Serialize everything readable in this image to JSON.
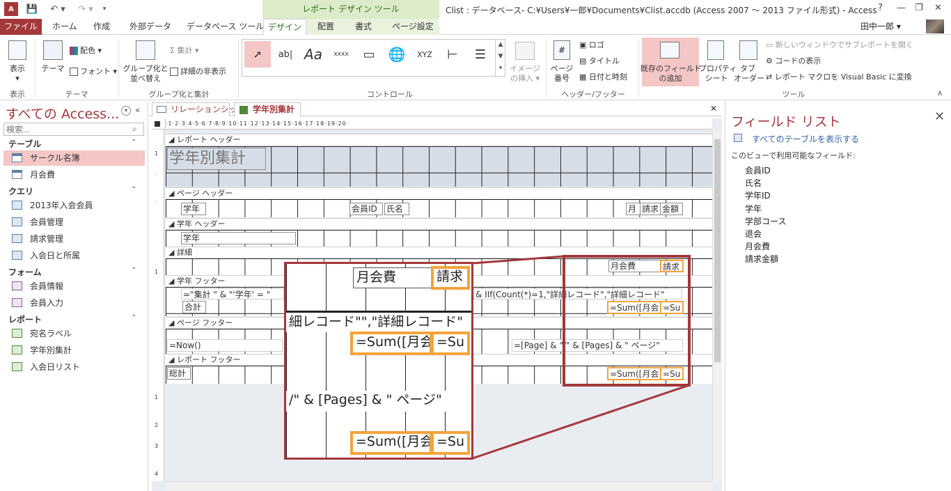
{
  "app": {
    "title": "Clist : データベース- C:¥Users¥一郎¥Documents¥Clist.accdb (Access 2007 ～ 2013 ファイル形式) - Access",
    "context_header": "レポート デザイン ツール",
    "help": "?",
    "user": "田中一郎 ▾"
  },
  "tabs": [
    "ファイル",
    "ホーム",
    "作成",
    "外部データ",
    "データベース ツール",
    "デザイン",
    "配置",
    "書式",
    "ページ設定"
  ],
  "ribbon": {
    "view": {
      "label": "表示",
      "group": "表示"
    },
    "theme": {
      "theme": "テーマ",
      "colors": "配色 ▾",
      "fonts": "フォント ▾",
      "group": "テーマ"
    },
    "grouping": {
      "group_sort": "グループ化と\n並べ替え",
      "totals": "集計 ▾",
      "hide_details": "詳細の非表示",
      "group": "グループ化と集計"
    },
    "controls": {
      "group": "コントロール",
      "image_insert": "イメージ\nの挿入 ▾"
    },
    "header_footer": {
      "page_number": "ページ\n番号",
      "logo": "ロゴ",
      "title": "タイトル",
      "datetime": "日付と時刻",
      "group": "ヘッダー/フッター"
    },
    "tools": {
      "add_fields": "既存のフィールド\nの追加",
      "property_sheet": "プロパティ\nシート",
      "tab_order": "タブ\nオーダー",
      "subreport": "新しいウィンドウでサブレポートを開く",
      "view_code": "コードの表示",
      "convert_macros": "レポート マクロを Visual Basic に変換",
      "group": "ツール"
    }
  },
  "nav": {
    "title": "すべての Access...",
    "search_placeholder": "検索...",
    "categories": [
      {
        "name": "テーブル",
        "items": [
          "サークル名簿",
          "月会費"
        ]
      },
      {
        "name": "クエリ",
        "items": [
          "2013年入会会員",
          "会員管理",
          "請求管理",
          "入会日と所属"
        ]
      },
      {
        "name": "フォーム",
        "items": [
          "会員情報",
          "会員入力"
        ]
      },
      {
        "name": "レポート",
        "items": [
          "宛名ラベル",
          "学年別集計",
          "入会日リスト"
        ]
      }
    ],
    "selected": "サークル名簿"
  },
  "doc_tabs": [
    "リレーションシップ",
    "学年別集計"
  ],
  "report": {
    "sections": {
      "report_header": "レポート ヘッダー",
      "page_header": "ページ ヘッダー",
      "group_header": "学年 ヘッダー",
      "detail": "詳細",
      "group_footer": "学年 フッター",
      "page_footer": "ページ フッター",
      "report_footer": "レポート フッター"
    },
    "title": "学年別集計",
    "ph_grade": "学年",
    "ph_id": "会員ID",
    "ph_name": "氏名",
    "ph_fee": "月",
    "ph_bill": "請求",
    "ph_amount": "金額",
    "gh_grade": "学年",
    "detail_fee": "月会費",
    "detail_bill": "請求",
    "gf_expr": "=\"集計 \" & \"'学年' = \"",
    "gf_expr2": "& IIf(Count(*)=1,\"詳細レコード\",\"詳細レコード\"",
    "gf_total": "合計",
    "gf_sum1": "=Sum([月会",
    "gf_sum2": "=Su",
    "pf_now": "=Now()",
    "pf_pages": "=[Page] & \"/\" & [Pages] & \" ページ\"",
    "rf_total": "総計",
    "rf_sum1": "=Sum([月会",
    "rf_sum2": "=Su"
  },
  "zoom": {
    "fee": "月会費",
    "bill": "請求",
    "record": "細レコード\"\",\"詳細レコード\"",
    "sum1": "=Sum([月会",
    "sum2": "=Su",
    "pages": "/\" & [Pages] & \" ページ\"",
    "sum3": "=Sum([月会",
    "sum4": "=Su"
  },
  "field_list": {
    "title": "フィールド リスト",
    "show_all": "すべてのテーブルを表示する",
    "hint": "このビューで利用可能なフィールド:",
    "fields": [
      "会員ID",
      "氏名",
      "学年ID",
      "学年",
      "学部コース",
      "退会",
      "月会費",
      "請求金額"
    ]
  },
  "colors": {
    "accent": "#a4373a",
    "context": "#dcebc9",
    "selection": "#f5a33a"
  }
}
